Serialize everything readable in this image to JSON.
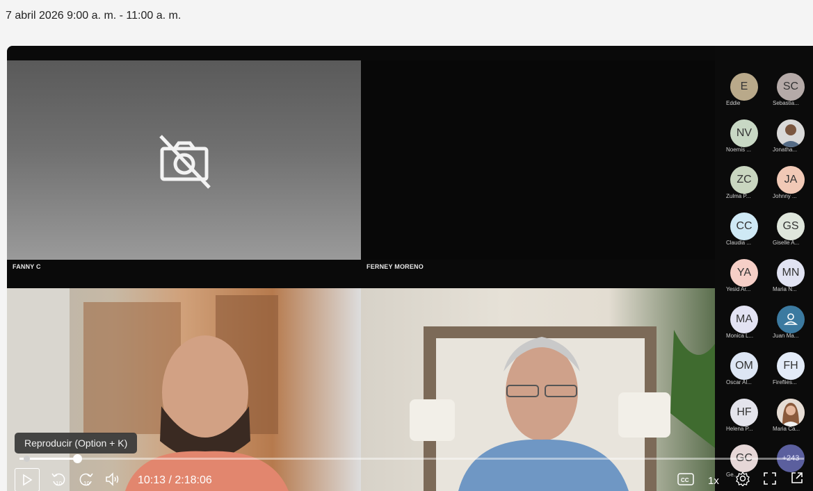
{
  "header": {
    "date_range": "7 abril 2026 9:00 a. m. - 11:00 a. m."
  },
  "tiles": {
    "fanny_label": "FANNY C",
    "ferney_label": "FERNEY MORENO"
  },
  "participants": [
    {
      "initials": "E",
      "name": "Eddie",
      "bg": "#b9a98a"
    },
    {
      "initials": "SC",
      "name": "Sebastia...",
      "bg": "#b5aaa8"
    },
    {
      "initials": "NV",
      "name": "Noemis ...",
      "bg": "#c8d8c4"
    },
    {
      "initials": "",
      "name": "Jonatha...",
      "bg": "#8a6a55",
      "photo": true
    },
    {
      "initials": "ZC",
      "name": "Zulma P...",
      "bg": "#c9d6c0"
    },
    {
      "initials": "JA",
      "name": "Johnny ...",
      "bg": "#f1c9b6"
    },
    {
      "initials": "CC",
      "name": "Claudia ...",
      "bg": "#cfe9f5"
    },
    {
      "initials": "GS",
      "name": "Giselle A...",
      "bg": "#dfe6dc"
    },
    {
      "initials": "YA",
      "name": "Yesid Ar...",
      "bg": "#f6cfc7"
    },
    {
      "initials": "MN",
      "name": "Maria N...",
      "bg": "#e1e3f2"
    },
    {
      "initials": "MA",
      "name": "Monica L...",
      "bg": "#e3e3f3"
    },
    {
      "initials": "",
      "name": "Juan Ma...",
      "bg": "#3c7aa0",
      "icon": true
    },
    {
      "initials": "OM",
      "name": "Oscar Al...",
      "bg": "#dde6f4"
    },
    {
      "initials": "FH",
      "name": "Fireflies...",
      "bg": "#e3ebf8"
    },
    {
      "initials": "HF",
      "name": "Helena P...",
      "bg": "#e4e4ec"
    },
    {
      "initials": "",
      "name": "Maria Ca...",
      "bg": "#c9a48a",
      "photo": true
    },
    {
      "initials": "GC",
      "name": "Ge...",
      "bg": "#e6d7d7"
    },
    {
      "initials": "+243",
      "name": "",
      "bg": "#5b5f9e"
    }
  ],
  "player": {
    "tooltip": "Reproducir (Option + K)",
    "time": "10:13 / 2:18:06",
    "speed": "1x",
    "progress_fraction": 0.074,
    "rewind_label": "10",
    "forward_label": "10",
    "cc_label": "CC"
  },
  "colors": {
    "player_bg": "#0a0a0a",
    "sidebar_bg": "#0b0b0b"
  }
}
